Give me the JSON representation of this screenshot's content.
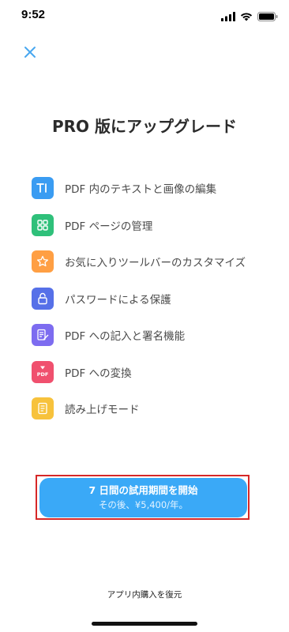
{
  "status_bar": {
    "time": "9:52"
  },
  "header": {
    "title": "PRO 版にアップグレード"
  },
  "features": [
    {
      "label": "PDF 内のテキストと画像の編集",
      "icon": "text-edit-icon",
      "color": "#3a9cf2"
    },
    {
      "label": "PDF ページの管理",
      "icon": "grid-pages-icon",
      "color": "#2fc07a"
    },
    {
      "label": "お気に入りツールバーのカスタマイズ",
      "icon": "star-icon",
      "color": "#ff9f43"
    },
    {
      "label": "パスワードによる保護",
      "icon": "lock-icon",
      "color": "#5670e8"
    },
    {
      "label": "PDF への記入と署名機能",
      "icon": "pen-document-icon",
      "color": "#7d6cf0"
    },
    {
      "label": "PDF への変換",
      "icon": "pdf-convert-icon",
      "color": "#f0506e"
    },
    {
      "label": "読み上げモード",
      "icon": "read-aloud-icon",
      "color": "#f7c23c"
    }
  ],
  "cta": {
    "main_label": "7 日間の試用期間を開始",
    "sub_label": "その後、¥5,400/年。",
    "color": "#3aa9f7"
  },
  "footer": {
    "restore_label": "アプリ内購入を復元"
  },
  "colors": {
    "close_icon": "#4aa8f0",
    "highlight_outline": "#d62828"
  }
}
